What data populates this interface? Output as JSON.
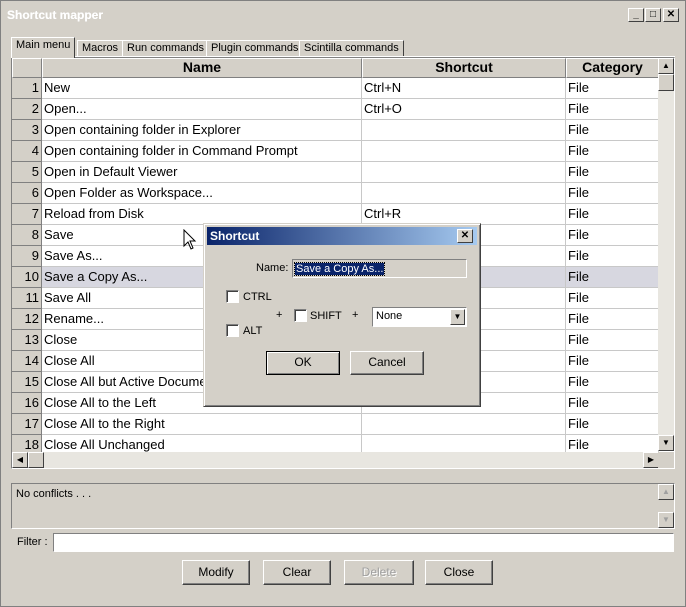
{
  "window": {
    "title": "Shortcut mapper",
    "min_label": "_",
    "max_label": "□",
    "close_label": "✕"
  },
  "tabs": [
    "Main menu",
    "Macros",
    "Run commands",
    "Plugin commands",
    "Scintilla commands"
  ],
  "table": {
    "columns": [
      "Name",
      "Shortcut",
      "Category"
    ],
    "rows": [
      {
        "num": "1",
        "name": "New",
        "shortcut": "Ctrl+N",
        "category": "File"
      },
      {
        "num": "2",
        "name": "Open...",
        "shortcut": "Ctrl+O",
        "category": "File"
      },
      {
        "num": "3",
        "name": "Open containing folder in Explorer",
        "shortcut": "",
        "category": "File"
      },
      {
        "num": "4",
        "name": "Open containing folder in Command Prompt",
        "shortcut": "",
        "category": "File"
      },
      {
        "num": "5",
        "name": "Open in Default Viewer",
        "shortcut": "",
        "category": "File"
      },
      {
        "num": "6",
        "name": "Open Folder as Workspace...",
        "shortcut": "",
        "category": "File"
      },
      {
        "num": "7",
        "name": "Reload from Disk",
        "shortcut": "Ctrl+R",
        "category": "File"
      },
      {
        "num": "8",
        "name": "Save",
        "shortcut": "",
        "category": "File"
      },
      {
        "num": "9",
        "name": "Save As...",
        "shortcut": "",
        "category": "File"
      },
      {
        "num": "10",
        "name": "Save a Copy As...",
        "shortcut": "",
        "category": "File"
      },
      {
        "num": "11",
        "name": "Save All",
        "shortcut": "",
        "category": "File"
      },
      {
        "num": "12",
        "name": "Rename...",
        "shortcut": "",
        "category": "File"
      },
      {
        "num": "13",
        "name": "Close",
        "shortcut": "",
        "category": "File"
      },
      {
        "num": "14",
        "name": "Close All",
        "shortcut": "",
        "category": "File"
      },
      {
        "num": "15",
        "name": "Close All but Active Document",
        "shortcut": "",
        "category": "File"
      },
      {
        "num": "16",
        "name": "Close All to the Left",
        "shortcut": "",
        "category": "File"
      },
      {
        "num": "17",
        "name": "Close All to the Right",
        "shortcut": "",
        "category": "File"
      },
      {
        "num": "18",
        "name": "Close All Unchanged",
        "shortcut": "",
        "category": "File"
      }
    ],
    "selected_row_index": 9
  },
  "conflicts": {
    "text": "No conflicts . . ."
  },
  "filter": {
    "label": "Filter :",
    "value": ""
  },
  "buttons": {
    "modify": "Modify",
    "clear": "Clear",
    "delete": "Delete",
    "close": "Close"
  },
  "dialog": {
    "title": "Shortcut",
    "close_label": "✕",
    "name_label": "Name:",
    "name_value": "Save a Copy As...",
    "ctrl_label": "CTRL",
    "alt_label": "ALT",
    "shift_label": "SHIFT",
    "plus": "+",
    "key_value": "None",
    "ok_label": "OK",
    "cancel_label": "Cancel"
  }
}
